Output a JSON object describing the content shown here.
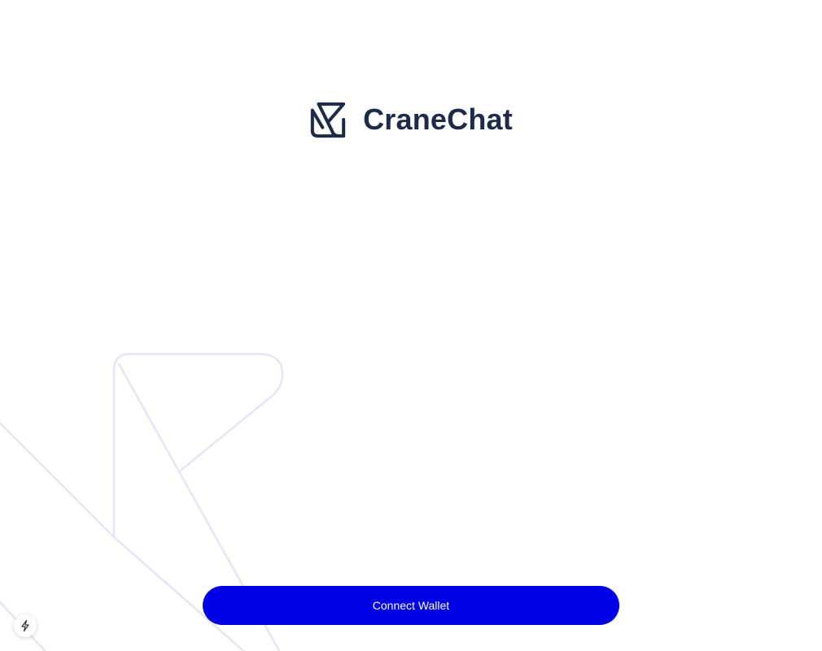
{
  "brand": {
    "name": "CraneChat",
    "logo_icon": "crane-logo-icon",
    "text_color": "#1e2a4a"
  },
  "actions": {
    "connect_wallet_label": "Connect Wallet",
    "button_color": "#0000e6"
  },
  "dev_indicator": {
    "icon": "lightning-bolt-icon"
  },
  "background": {
    "decoration": "crane-outline-icon",
    "line_color": "#e4e4fb"
  }
}
